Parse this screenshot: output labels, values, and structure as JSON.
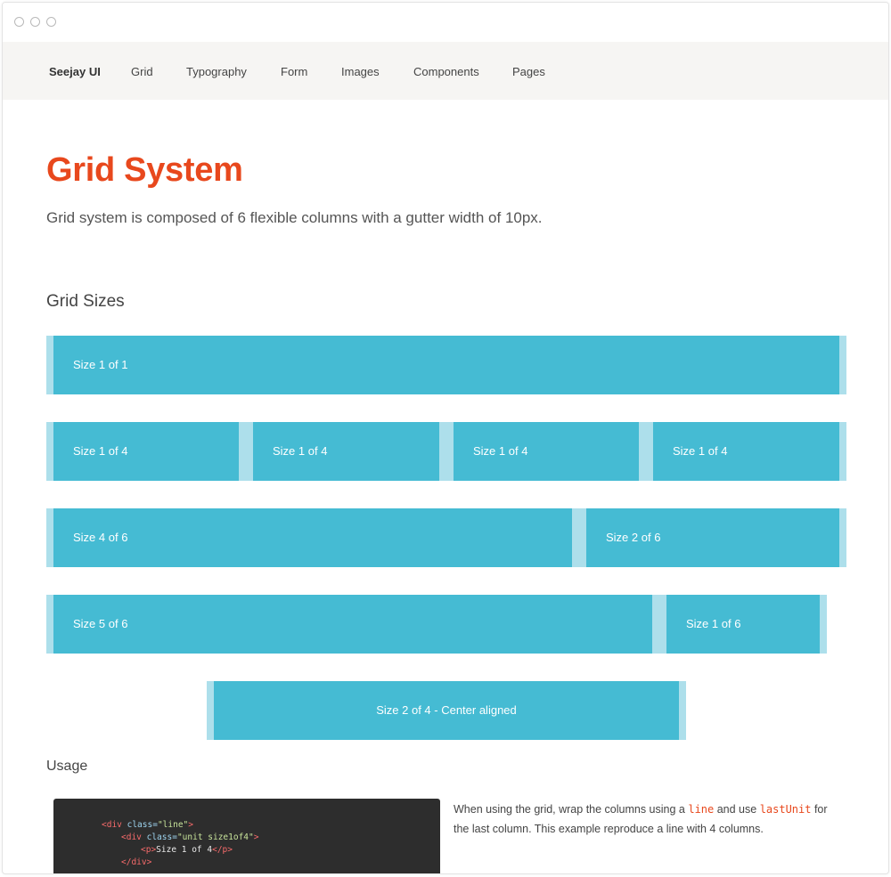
{
  "window": {
    "controls": [
      "window-dot",
      "window-dot",
      "window-dot"
    ]
  },
  "nav": {
    "brand": "Seejay UI",
    "items": [
      {
        "label": "Grid"
      },
      {
        "label": "Typography"
      },
      {
        "label": "Form"
      },
      {
        "label": "Images"
      },
      {
        "label": "Components"
      },
      {
        "label": "Pages"
      }
    ]
  },
  "page": {
    "title": "Grid System",
    "lead": "Grid system is composed of 6 flexible columns with a gutter width of 10px."
  },
  "grid_sizes": {
    "heading": "Grid Sizes",
    "rows": [
      {
        "units": [
          {
            "label": "Size 1 of 1"
          }
        ]
      },
      {
        "units": [
          {
            "label": "Size 1 of 4"
          },
          {
            "label": "Size 1 of 4"
          },
          {
            "label": "Size 1 of 4"
          },
          {
            "label": "Size 1 of 4"
          }
        ]
      },
      {
        "units": [
          {
            "label": "Size 4 of 6"
          },
          {
            "label": "Size 2 of 6"
          }
        ]
      },
      {
        "units": [
          {
            "label": "Size 5 of 6"
          },
          {
            "label": "Size 1 of 6"
          }
        ]
      },
      {
        "units": [
          {
            "label": "Size 2 of 4 - Center aligned"
          }
        ]
      }
    ]
  },
  "usage": {
    "heading": "Usage",
    "code": {
      "line1": {
        "open": "<div ",
        "attr": "class=",
        "val": "\"line\"",
        "close": ">"
      },
      "line2": {
        "open": "<div ",
        "attr": "class=",
        "val": "\"unit size1of4\"",
        "close": ">"
      },
      "line3": {
        "open": "<p>",
        "text": "Size 1 of 4",
        "close": "</p>"
      },
      "line4": {
        "close": "</div>"
      }
    },
    "text_before": "When using the grid, wrap the columns using a ",
    "code_term_1": "line",
    "text_middle": " and use ",
    "code_term_2": "lastUnit",
    "text_after": " for the last column. This example reproduce a line with 4 columns."
  },
  "colors": {
    "accent": "#e8481d",
    "grid_unit": "#45bbd3",
    "grid_gutter": "#addfeb",
    "nav_bg": "#f6f5f3",
    "code_bg": "#2d2d2d"
  }
}
